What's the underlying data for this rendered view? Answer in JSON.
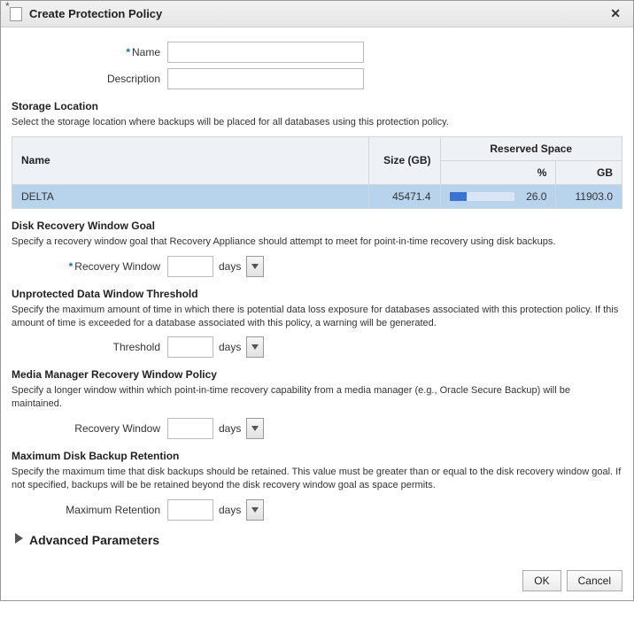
{
  "dialog": {
    "title": "Create Protection Policy",
    "close_glyph": "✕"
  },
  "fields": {
    "name_label": "Name",
    "name_value": "",
    "desc_label": "Description",
    "desc_value": ""
  },
  "storage": {
    "heading": "Storage Location",
    "desc": "Select the storage location where backups will be placed for all databases using this protection policy.",
    "cols": {
      "name": "Name",
      "size": "Size (GB)",
      "reserved": "Reserved Space",
      "pct": "%",
      "gb": "GB"
    },
    "rows": [
      {
        "name": "DELTA",
        "size": "45471.4",
        "pct": 26.0,
        "pct_label": "26.0",
        "gb": "11903.0",
        "selected": true
      }
    ]
  },
  "disk_window": {
    "heading": "Disk Recovery Window Goal",
    "desc": "Specify a recovery window goal that Recovery Appliance should attempt to meet for point-in-time recovery using disk backups.",
    "label": "Recovery Window",
    "value": "",
    "unit": "days"
  },
  "unprotected": {
    "heading": "Unprotected Data Window Threshold",
    "desc": "Specify the maximum amount of time in which there is potential data loss exposure for databases associated with this protection policy. If this amount of time is exceeded for a database associated with this policy, a warning will be generated.",
    "label": "Threshold",
    "value": "",
    "unit": "days"
  },
  "media": {
    "heading": "Media Manager Recovery Window Policy",
    "desc": "Specify a longer window within which point-in-time recovery capability from a media manager (e.g., Oracle Secure Backup) will be maintained.",
    "label": "Recovery Window",
    "value": "",
    "unit": "days"
  },
  "retention": {
    "heading": "Maximum Disk Backup Retention",
    "desc": "Specify the maximum time that disk backups should be retained. This value must be greater than or equal to the disk recovery window goal. If not specified, backups will be be retained beyond the disk recovery window goal as space permits.",
    "label": "Maximum Retention",
    "value": "",
    "unit": "days"
  },
  "adv": {
    "label": "Advanced Parameters"
  },
  "buttons": {
    "ok": "OK",
    "cancel": "Cancel"
  }
}
